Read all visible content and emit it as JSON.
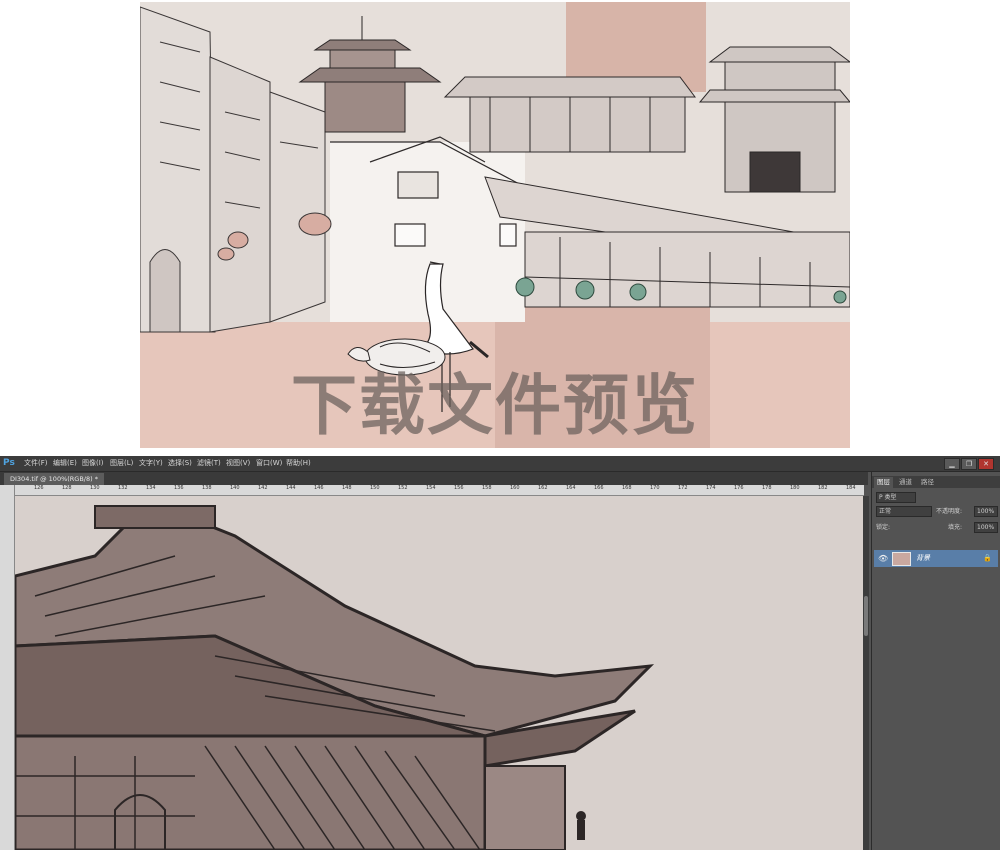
{
  "preview": {
    "watermark_text": "下载文件预览"
  },
  "photoshop": {
    "logo": "Ps",
    "menus": [
      "文件(F)",
      "编辑(E)",
      "图像(I)",
      "图层(L)",
      "文字(Y)",
      "选择(S)",
      "滤镜(T)",
      "视图(V)",
      "窗口(W)",
      "帮助(H)"
    ],
    "window_buttons": [
      "▁",
      "❐",
      "✕"
    ],
    "document_tab": "DI304.tif @ 100%(RGB/8) *",
    "ruler_labels": [
      "126",
      "128",
      "130",
      "132",
      "134",
      "136",
      "138",
      "140",
      "142",
      "144",
      "146",
      "148",
      "150",
      "152",
      "154",
      "156",
      "158",
      "160",
      "162",
      "164",
      "166",
      "168",
      "170",
      "172",
      "174",
      "176",
      "178",
      "180",
      "182",
      "184"
    ],
    "panel": {
      "tabs": [
        "图层",
        "通道",
        "路径"
      ],
      "filter_label": "P 类型",
      "blend_mode": "正常",
      "opacity_label": "不透明度:",
      "opacity_value": "100%",
      "lock_label": "锁定:",
      "fill_label": "填充:",
      "fill_value": "100%",
      "layer_name": "背景",
      "visibility_icon": "eye-icon",
      "lock_icon": "lock-icon"
    }
  }
}
